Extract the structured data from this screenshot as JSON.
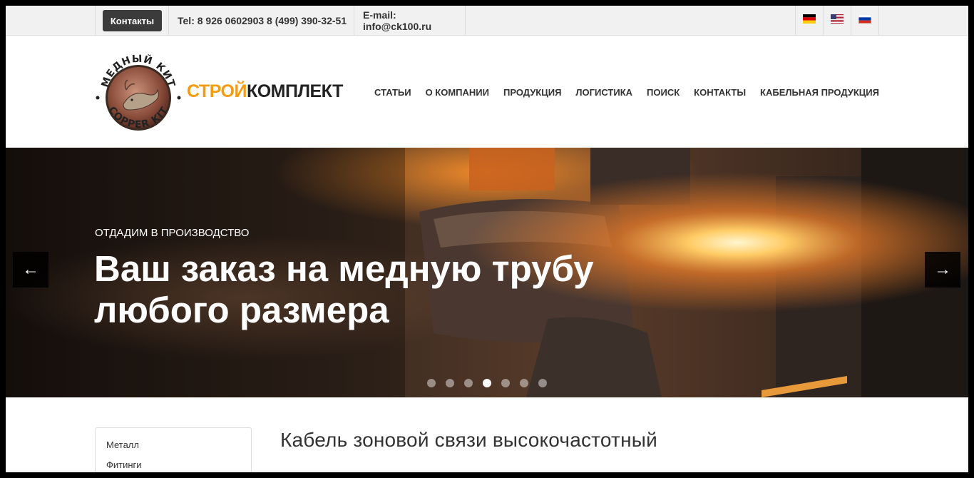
{
  "topbar": {
    "contacts_button": "Контакты",
    "phone": "Tel: 8 926 0602903 8 (499) 390-32-51",
    "email": "E-mail: info@ck100.ru",
    "languages": [
      "de-flag-icon",
      "us-flag-icon",
      "ru-flag-icon"
    ]
  },
  "header": {
    "logo_text_top": "МЕДНЫЙ КИТ",
    "logo_text_bottom": "COPPER KIT",
    "brand_part1": "СТРОЙ",
    "brand_part2": "КОМПЛЕКТ",
    "nav": [
      "СТАТЬИ",
      "О КОМПАНИИ",
      "ПРОДУКЦИЯ",
      "ЛОГИСТИКА",
      "ПОИСК",
      "КОНТАКТЫ",
      "КАБЕЛЬНАЯ ПРОДУКЦИЯ"
    ]
  },
  "slider": {
    "eyebrow": "ОТДАДИМ В ПРОИЗВОДСТВО",
    "title": "Ваш заказ на медную трубу любого размера",
    "prev_icon": "arrow-left-icon",
    "next_icon": "arrow-right-icon",
    "slide_count": 7,
    "active_index": 3
  },
  "sidebar": {
    "items": [
      "Металл",
      "Фитинги"
    ]
  },
  "main": {
    "heading": "Кабель зоновой связи высокочастотный"
  },
  "colors": {
    "accent": "#f39c12",
    "dark_button": "#3b3b3b"
  }
}
